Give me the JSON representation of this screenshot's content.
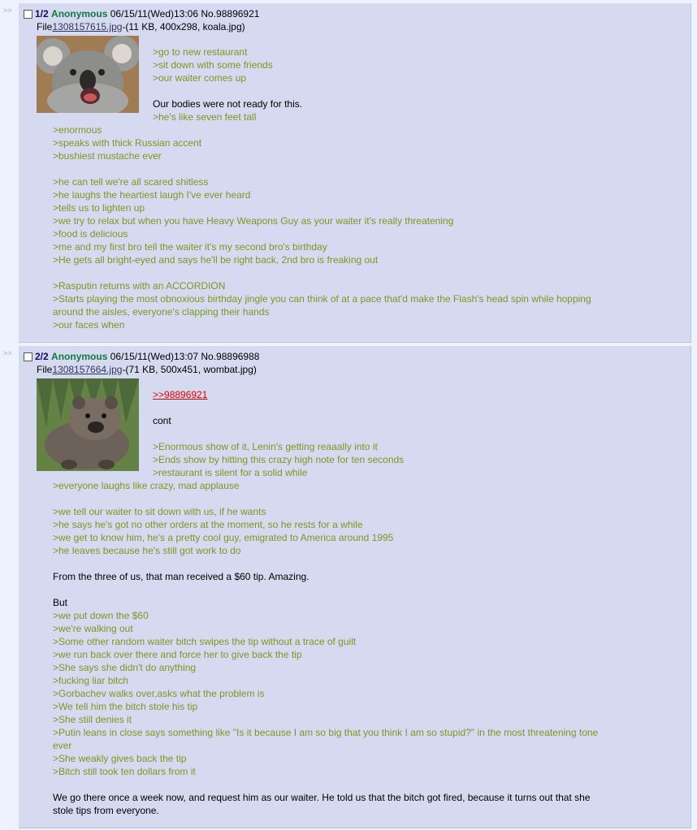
{
  "arrows": ">>",
  "posts": [
    {
      "counter": "1/2",
      "name": "Anonymous",
      "datetime": "06/15/11(Wed)13:06",
      "number": "No.98896921",
      "file_prefix": "File",
      "file_name": "1308157615.jpg",
      "file_info": "-(11 KB, 400x298, koala.jpg)",
      "thumb_icon": "koala-thumbnail",
      "lines": [
        {
          "t": ">go to new restaurant",
          "k": "quote"
        },
        {
          "t": ">sit down with some friends",
          "k": "quote"
        },
        {
          "t": ">our waiter comes up",
          "k": "quote"
        },
        {
          "t": "",
          "k": "blank"
        },
        {
          "t": "Our bodies were not ready for this.",
          "k": "plain"
        },
        {
          "t": ">he's like seven feet tall",
          "k": "quote"
        },
        {
          "t": ">enormous",
          "k": "quote"
        },
        {
          "t": ">speaks with thick Russian accent",
          "k": "quote"
        },
        {
          "t": ">bushiest mustache ever",
          "k": "quote"
        },
        {
          "t": "",
          "k": "blank"
        },
        {
          "t": ">he can tell we're all scared shitless",
          "k": "quote"
        },
        {
          "t": ">he laughs the heartiest laugh I've ever heard",
          "k": "quote"
        },
        {
          "t": ">tells us to lighten up",
          "k": "quote"
        },
        {
          "t": ">we try to relax but when you have Heavy Weapons Guy as your waiter it's really threatening",
          "k": "quote"
        },
        {
          "t": ">food is delicious",
          "k": "quote"
        },
        {
          "t": ">me and my first bro tell the waiter it's my second bro's birthday",
          "k": "quote"
        },
        {
          "t": ">He gets all bright-eyed and says he'll be right back, 2nd bro is freaking out",
          "k": "quote"
        },
        {
          "t": "",
          "k": "blank"
        },
        {
          "t": ">Rasputin returns with an ACCORDION",
          "k": "quote"
        },
        {
          "t": ">Starts playing the most obnoxious birthday jingle you can think of at a pace that'd make the Flash's head spin while hopping",
          "k": "quote"
        },
        {
          "t": "around the aisles, everyone's clapping their hands",
          "k": "quote"
        },
        {
          "t": ">our faces when",
          "k": "quote"
        }
      ]
    },
    {
      "counter": "2/2",
      "name": "Anonymous",
      "datetime": "06/15/11(Wed)13:07",
      "number": "No.98896988",
      "file_prefix": "File",
      "file_name": "1308157664.jpg",
      "file_info": "-(71 KB, 500x451, wombat.jpg)",
      "thumb_icon": "wombat-thumbnail",
      "lines": [
        {
          "t": ">>98896921",
          "k": "link"
        },
        {
          "t": "",
          "k": "blank"
        },
        {
          "t": "cont",
          "k": "plain"
        },
        {
          "t": "",
          "k": "blank"
        },
        {
          "t": ">Enormous show of it, Lenin's getting reaaally into it",
          "k": "quote"
        },
        {
          "t": ">Ends show by hitting this crazy high note for ten seconds",
          "k": "quote"
        },
        {
          "t": ">restaurant is silent for a solid while",
          "k": "quote"
        },
        {
          "t": ">everyone laughs like crazy, mad applause",
          "k": "quote"
        },
        {
          "t": "",
          "k": "blank"
        },
        {
          "t": ">we tell our waiter to sit down with us, if he wants",
          "k": "quote"
        },
        {
          "t": ">he says he's got no other orders at the moment, so he rests for a while",
          "k": "quote"
        },
        {
          "t": ">we get to know him, he's a pretty cool guy, emigrated to America around 1995",
          "k": "quote"
        },
        {
          "t": ">he leaves because he's still got work to do",
          "k": "quote"
        },
        {
          "t": "",
          "k": "blank"
        },
        {
          "t": "From the three of us, that man received a $60 tip. Amazing.",
          "k": "plain"
        },
        {
          "t": "",
          "k": "blank"
        },
        {
          "t": "But",
          "k": "plain"
        },
        {
          "t": ">we put down the $60",
          "k": "quote"
        },
        {
          "t": ">we're walking out",
          "k": "quote"
        },
        {
          "t": ">Some other random waiter bitch swipes the tip without a trace of guilt",
          "k": "quote"
        },
        {
          "t": ">we run back over there and force her to give back the tip",
          "k": "quote"
        },
        {
          "t": ">She says she didn't do anything",
          "k": "quote"
        },
        {
          "t": ">fucking liar bitch",
          "k": "quote"
        },
        {
          "t": ">Gorbachev walks over,asks what the problem is",
          "k": "quote"
        },
        {
          "t": ">We tell him the bitch stole his tip",
          "k": "quote"
        },
        {
          "t": ">She still denies it",
          "k": "quote"
        },
        {
          "t": ">Putin leans in close says something like \"Is it because I am so big that you think I am so stupid?\" in the most threatening tone",
          "k": "quote"
        },
        {
          "t": "ever",
          "k": "quote"
        },
        {
          "t": ">She weakly gives back the tip",
          "k": "quote"
        },
        {
          "t": ">Bitch still took ten dollars from it",
          "k": "quote"
        },
        {
          "t": "",
          "k": "blank"
        },
        {
          "t": "We go there once a week now, and request him as our waiter. He told us that the bitch got fired, because it turns out that she",
          "k": "plain"
        },
        {
          "t": "stole tips from everyone.",
          "k": "plain"
        }
      ]
    }
  ]
}
